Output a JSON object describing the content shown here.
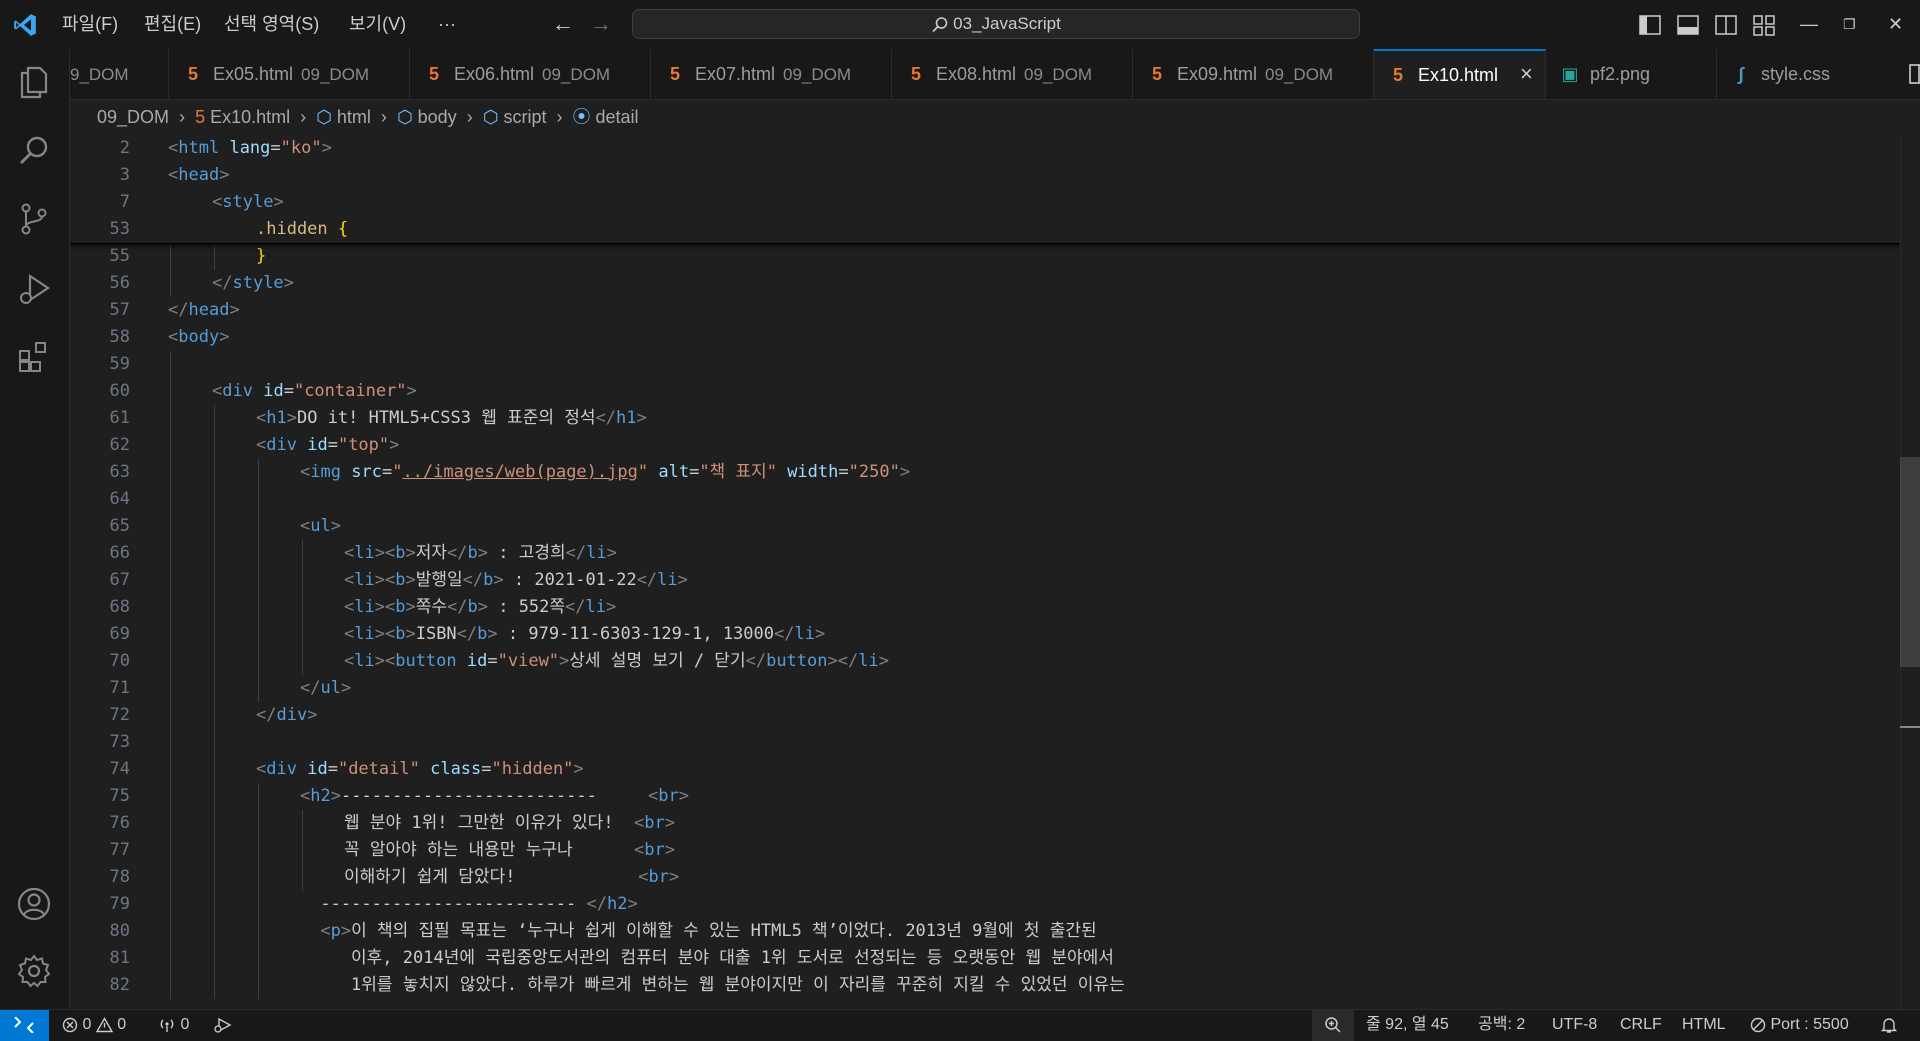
{
  "window": {
    "search_label": "03_JavaScript"
  },
  "menu": [
    {
      "label": "파일(F)"
    },
    {
      "label": "편집(E)"
    },
    {
      "label": "선택 영역(S)"
    },
    {
      "label": "보기(V)"
    },
    {
      "label": "···"
    }
  ],
  "tabs": [
    {
      "name": "",
      "desc": "9_DOM",
      "icon": "html5",
      "active": false
    },
    {
      "name": "Ex05.html",
      "desc": "09_DOM",
      "icon": "html5",
      "active": false
    },
    {
      "name": "Ex06.html",
      "desc": "09_DOM",
      "icon": "html5",
      "active": false
    },
    {
      "name": "Ex07.html",
      "desc": "09_DOM",
      "icon": "html5",
      "active": false
    },
    {
      "name": "Ex08.html",
      "desc": "09_DOM",
      "icon": "html5",
      "active": false
    },
    {
      "name": "Ex09.html",
      "desc": "09_DOM",
      "icon": "html5",
      "active": false
    },
    {
      "name": "Ex10.html",
      "desc": "",
      "icon": "html5",
      "active": true
    },
    {
      "name": "pf2.png",
      "desc": "",
      "icon": "image",
      "active": false
    },
    {
      "name": "style.css",
      "desc": "",
      "icon": "css",
      "active": false
    }
  ],
  "breadcrumb": [
    "09_DOM",
    "Ex10.html",
    "html",
    "body",
    "script",
    "detail"
  ],
  "sticky_lines": [
    {
      "n": "2",
      "indent": 0,
      "tokens": [
        [
          "br",
          "<"
        ],
        [
          "tag",
          "html"
        ],
        [
          "txt",
          " "
        ],
        [
          "attr",
          "lang"
        ],
        [
          "txt",
          "="
        ],
        [
          "str",
          "\"ko\""
        ],
        [
          "br",
          ">"
        ]
      ]
    },
    {
      "n": "3",
      "indent": 0,
      "tokens": [
        [
          "br",
          "<"
        ],
        [
          "tag",
          "head"
        ],
        [
          "br",
          ">"
        ]
      ]
    },
    {
      "n": "7",
      "indent": 1,
      "tokens": [
        [
          "br",
          "<"
        ],
        [
          "tag",
          "style"
        ],
        [
          "br",
          ">"
        ]
      ]
    },
    {
      "n": "53",
      "indent": 2,
      "tokens": [
        [
          "sel",
          ".hidden"
        ],
        [
          "txt",
          " "
        ],
        [
          "brace",
          "{"
        ]
      ]
    }
  ],
  "lines": [
    {
      "n": "55",
      "indent": 2,
      "tokens": [
        [
          "brace",
          "}"
        ]
      ]
    },
    {
      "n": "56",
      "indent": 1,
      "tokens": [
        [
          "br",
          "</"
        ],
        [
          "tag",
          "style"
        ],
        [
          "br",
          ">"
        ]
      ]
    },
    {
      "n": "57",
      "indent": 0,
      "tokens": [
        [
          "br",
          "</"
        ],
        [
          "tag",
          "head"
        ],
        [
          "br",
          ">"
        ]
      ]
    },
    {
      "n": "58",
      "indent": 0,
      "tokens": [
        [
          "br",
          "<"
        ],
        [
          "tag",
          "body"
        ],
        [
          "br",
          ">"
        ]
      ]
    },
    {
      "n": "59",
      "indent": 1,
      "tokens": []
    },
    {
      "n": "60",
      "indent": 1,
      "tokens": [
        [
          "br",
          "<"
        ],
        [
          "tag",
          "div"
        ],
        [
          "txt",
          " "
        ],
        [
          "attr",
          "id"
        ],
        [
          "txt",
          "="
        ],
        [
          "str",
          "\"container\""
        ],
        [
          "br",
          ">"
        ]
      ]
    },
    {
      "n": "61",
      "indent": 2,
      "tokens": [
        [
          "br",
          "<"
        ],
        [
          "tag",
          "h1"
        ],
        [
          "br",
          ">"
        ],
        [
          "txt",
          "DO it! HTML5+CSS3 웹 표준의 정석"
        ],
        [
          "br",
          "</"
        ],
        [
          "tag",
          "h1"
        ],
        [
          "br",
          ">"
        ]
      ]
    },
    {
      "n": "62",
      "indent": 2,
      "tokens": [
        [
          "br",
          "<"
        ],
        [
          "tag",
          "div"
        ],
        [
          "txt",
          " "
        ],
        [
          "attr",
          "id"
        ],
        [
          "txt",
          "="
        ],
        [
          "str",
          "\"top\""
        ],
        [
          "br",
          ">"
        ]
      ]
    },
    {
      "n": "63",
      "indent": 3,
      "tokens": [
        [
          "br",
          "<"
        ],
        [
          "tag",
          "img"
        ],
        [
          "txt",
          " "
        ],
        [
          "attr",
          "src"
        ],
        [
          "txt",
          "="
        ],
        [
          "str",
          "\""
        ],
        [
          "link",
          "../images/web(page).jpg"
        ],
        [
          "str",
          "\""
        ],
        [
          "txt",
          " "
        ],
        [
          "attr",
          "alt"
        ],
        [
          "txt",
          "="
        ],
        [
          "str",
          "\"책 표지\""
        ],
        [
          "txt",
          " "
        ],
        [
          "attr",
          "width"
        ],
        [
          "txt",
          "="
        ],
        [
          "str",
          "\"250\""
        ],
        [
          "br",
          ">"
        ]
      ]
    },
    {
      "n": "64",
      "indent": 3,
      "tokens": []
    },
    {
      "n": "65",
      "indent": 3,
      "tokens": [
        [
          "br",
          "<"
        ],
        [
          "tag",
          "ul"
        ],
        [
          "br",
          ">"
        ]
      ]
    },
    {
      "n": "66",
      "indent": 4,
      "tokens": [
        [
          "br",
          "<"
        ],
        [
          "tag",
          "li"
        ],
        [
          "br",
          "><"
        ],
        [
          "tag",
          "b"
        ],
        [
          "br",
          ">"
        ],
        [
          "txt",
          "저자"
        ],
        [
          "br",
          "</"
        ],
        [
          "tag",
          "b"
        ],
        [
          "br",
          ">"
        ],
        [
          "txt",
          " : 고경희"
        ],
        [
          "br",
          "</"
        ],
        [
          "tag",
          "li"
        ],
        [
          "br",
          ">"
        ]
      ]
    },
    {
      "n": "67",
      "indent": 4,
      "tokens": [
        [
          "br",
          "<"
        ],
        [
          "tag",
          "li"
        ],
        [
          "br",
          "><"
        ],
        [
          "tag",
          "b"
        ],
        [
          "br",
          ">"
        ],
        [
          "txt",
          "발행일"
        ],
        [
          "br",
          "</"
        ],
        [
          "tag",
          "b"
        ],
        [
          "br",
          ">"
        ],
        [
          "txt",
          " : 2021-01-22"
        ],
        [
          "br",
          "</"
        ],
        [
          "tag",
          "li"
        ],
        [
          "br",
          ">"
        ]
      ]
    },
    {
      "n": "68",
      "indent": 4,
      "tokens": [
        [
          "br",
          "<"
        ],
        [
          "tag",
          "li"
        ],
        [
          "br",
          "><"
        ],
        [
          "tag",
          "b"
        ],
        [
          "br",
          ">"
        ],
        [
          "txt",
          "쪽수"
        ],
        [
          "br",
          "</"
        ],
        [
          "tag",
          "b"
        ],
        [
          "br",
          ">"
        ],
        [
          "txt",
          " : 552쪽"
        ],
        [
          "br",
          "</"
        ],
        [
          "tag",
          "li"
        ],
        [
          "br",
          ">"
        ]
      ]
    },
    {
      "n": "69",
      "indent": 4,
      "tokens": [
        [
          "br",
          "<"
        ],
        [
          "tag",
          "li"
        ],
        [
          "br",
          "><"
        ],
        [
          "tag",
          "b"
        ],
        [
          "br",
          ">"
        ],
        [
          "txt",
          "ISBN"
        ],
        [
          "br",
          "</"
        ],
        [
          "tag",
          "b"
        ],
        [
          "br",
          ">"
        ],
        [
          "txt",
          " : 979-11-6303-129-1, 13000"
        ],
        [
          "br",
          "</"
        ],
        [
          "tag",
          "li"
        ],
        [
          "br",
          ">"
        ]
      ]
    },
    {
      "n": "70",
      "indent": 4,
      "tokens": [
        [
          "br",
          "<"
        ],
        [
          "tag",
          "li"
        ],
        [
          "br",
          "><"
        ],
        [
          "tag",
          "button"
        ],
        [
          "txt",
          " "
        ],
        [
          "attr",
          "id"
        ],
        [
          "txt",
          "="
        ],
        [
          "str",
          "\"view\""
        ],
        [
          "br",
          ">"
        ],
        [
          "txt",
          "상세 설명 보기 / 닫기"
        ],
        [
          "br",
          "</"
        ],
        [
          "tag",
          "button"
        ],
        [
          "br",
          "></"
        ],
        [
          "tag",
          "li"
        ],
        [
          "br",
          ">"
        ]
      ]
    },
    {
      "n": "71",
      "indent": 3,
      "tokens": [
        [
          "br",
          "</"
        ],
        [
          "tag",
          "ul"
        ],
        [
          "br",
          ">"
        ]
      ]
    },
    {
      "n": "72",
      "indent": 2,
      "tokens": [
        [
          "br",
          "</"
        ],
        [
          "tag",
          "div"
        ],
        [
          "br",
          ">"
        ]
      ]
    },
    {
      "n": "73",
      "indent": 2,
      "tokens": []
    },
    {
      "n": "74",
      "indent": 2,
      "tokens": [
        [
          "br",
          "<"
        ],
        [
          "tag",
          "div"
        ],
        [
          "txt",
          " "
        ],
        [
          "attr",
          "id"
        ],
        [
          "txt",
          "="
        ],
        [
          "str",
          "\"detail\""
        ],
        [
          "txt",
          " "
        ],
        [
          "attr",
          "class"
        ],
        [
          "txt",
          "="
        ],
        [
          "str",
          "\"hidden\""
        ],
        [
          "br",
          ">"
        ]
      ]
    },
    {
      "n": "75",
      "indent": 3,
      "tokens": [
        [
          "br",
          "<"
        ],
        [
          "tag",
          "h2"
        ],
        [
          "br",
          ">"
        ],
        [
          "txt",
          "-------------------------     "
        ],
        [
          "br",
          "<"
        ],
        [
          "tag",
          "br"
        ],
        [
          "br",
          ">"
        ]
      ]
    },
    {
      "n": "76",
      "indent": 4,
      "tokens": [
        [
          "txt",
          "웹 분야 1위! 그만한 이유가 있다!  "
        ],
        [
          "br",
          "<"
        ],
        [
          "tag",
          "br"
        ],
        [
          "br",
          ">"
        ]
      ]
    },
    {
      "n": "77",
      "indent": 4,
      "tokens": [
        [
          "txt",
          "꼭 알아야 하는 내용만 누구나      "
        ],
        [
          "br",
          "<"
        ],
        [
          "tag",
          "br"
        ],
        [
          "br",
          ">"
        ]
      ]
    },
    {
      "n": "78",
      "indent": 4,
      "tokens": [
        [
          "txt",
          "이해하기 쉽게 담았다!            "
        ],
        [
          "br",
          "<"
        ],
        [
          "tag",
          "br"
        ],
        [
          "br",
          ">"
        ]
      ]
    },
    {
      "n": "79",
      "indent": 3,
      "extra": 2,
      "tokens": [
        [
          "txt",
          "------------------------- "
        ],
        [
          "br",
          "</"
        ],
        [
          "tag",
          "h2"
        ],
        [
          "br",
          ">"
        ]
      ]
    },
    {
      "n": "80",
      "indent": 3,
      "extra": 2,
      "tokens": [
        [
          "br",
          "<"
        ],
        [
          "tag",
          "p"
        ],
        [
          "br",
          ">"
        ],
        [
          "txt",
          "이 책의 집필 목표는 ‘누구나 쉽게 이해할 수 있는 HTML5 책’이었다. 2013년 9월에 첫 출간된"
        ]
      ]
    },
    {
      "n": "81",
      "indent": 3,
      "extra": 5,
      "tokens": [
        [
          "txt",
          "이후, 2014년에 국립중앙도서관의 컴퓨터 분야 대출 1위 도서로 선정되는 등 오랫동안 웹 분야에서"
        ]
      ]
    },
    {
      "n": "82",
      "indent": 3,
      "extra": 5,
      "tokens": [
        [
          "txt",
          "1위를 놓치지 않았다. 하루가 빠르게 변하는 웹 분야이지만 이 자리를 꾸준히 지킬 수 있었던 이유는"
        ]
      ]
    }
  ],
  "status": {
    "errors": "0",
    "warnings": "0",
    "ports": "0",
    "position": "줄 92, 열 45",
    "spaces": "공백: 2",
    "encoding": "UTF-8",
    "eol": "CRLF",
    "language": "HTML",
    "port": "Port : 5500"
  },
  "colors": {
    "accent": "#0078d4",
    "background": "#1f1f1f",
    "bar": "#181818"
  }
}
